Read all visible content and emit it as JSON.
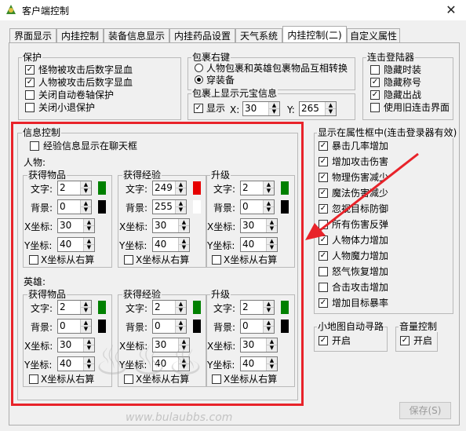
{
  "window": {
    "title": "客户端控制",
    "close": "✕"
  },
  "tabs": [
    "界面显示",
    "内挂控制",
    "装备信息显示",
    "内挂药品设置",
    "天气系统",
    "内挂控制(二)",
    "自定义属性"
  ],
  "protect": {
    "label": "保护",
    "items": [
      {
        "label": "怪物被攻击后数字显血",
        "checked": true
      },
      {
        "label": "人物被攻击后数字显血",
        "checked": true
      },
      {
        "label": "关闭自动卷轴保护",
        "checked": false
      },
      {
        "label": "关闭小退保护",
        "checked": false
      }
    ]
  },
  "bag": {
    "label": "包裹右键",
    "options": [
      "人物包裹和英雄包裹物品互相转换",
      "穿装备"
    ],
    "selected": 1
  },
  "ingot": {
    "label": "包裹上显示元宝信息",
    "show_label": "显示",
    "show_checked": true,
    "x_label": "X:",
    "x": "30",
    "y_label": "Y:",
    "y": "265"
  },
  "login": {
    "label": "连击登陆器",
    "items": [
      {
        "label": "隐藏时装",
        "checked": false
      },
      {
        "label": "隐藏称号",
        "checked": true
      },
      {
        "label": "隐藏出战",
        "checked": true
      },
      {
        "label": "使用旧连击界面",
        "checked": false
      }
    ]
  },
  "info": {
    "label": "信息控制",
    "exp_chat": {
      "label": "经验信息显示在聊天框",
      "checked": false
    },
    "person_label": "人物:",
    "hero_label": "英雄:",
    "text_label": "文字:",
    "bg_label": "背景:",
    "x_label": "X坐标:",
    "y_label": "Y坐标:",
    "right_label": "X坐标从右算",
    "person": [
      {
        "title": "获得物品",
        "text": "2",
        "bg": "0",
        "x": "30",
        "y": "40",
        "text_color": "#008000",
        "bg_color": "#000000"
      },
      {
        "title": "获得经验",
        "text": "249",
        "bg": "255",
        "x": "30",
        "y": "40",
        "text_color": "#e60000",
        "bg_color": "#ffffff"
      },
      {
        "title": "升级",
        "text": "2",
        "bg": "0",
        "x": "30",
        "y": "40",
        "text_color": "#008000",
        "bg_color": "#000000"
      }
    ],
    "hero": [
      {
        "title": "获得物品",
        "text": "2",
        "bg": "0",
        "x": "30",
        "y": "40",
        "text_color": "#008000",
        "bg_color": "#000000"
      },
      {
        "title": "获得经验",
        "text": "2",
        "bg": "0",
        "x": "30",
        "y": "40",
        "text_color": "#008000",
        "bg_color": "#000000"
      },
      {
        "title": "升级",
        "text": "2",
        "bg": "0",
        "x": "30",
        "y": "40",
        "text_color": "#008000",
        "bg_color": "#000000"
      }
    ]
  },
  "attr": {
    "label": "显示在属性框中(连击登录器有效)",
    "items": [
      {
        "label": "暴击几率增加",
        "checked": true
      },
      {
        "label": "增加攻击伤害",
        "checked": true
      },
      {
        "label": "物理伤害减少",
        "checked": true
      },
      {
        "label": "魔法伤害减少",
        "checked": true
      },
      {
        "label": "忽视目标防御",
        "checked": true
      },
      {
        "label": "所有伤害反弹",
        "checked": false
      },
      {
        "label": "人物体力增加",
        "checked": true
      },
      {
        "label": "人物魔力增加",
        "checked": true
      },
      {
        "label": "怒气恢复增加",
        "checked": false
      },
      {
        "label": "合击攻击增加",
        "checked": false
      },
      {
        "label": "增加目标暴率",
        "checked": true
      }
    ]
  },
  "minimap": {
    "label": "小地图自动寻路",
    "enable_label": "开启",
    "checked": true
  },
  "sound": {
    "label": "音量控制",
    "enable_label": "开启",
    "checked": true
  },
  "save_label": "保存(S)",
  "watermark": "www.bulaubbs.com",
  "colors": {
    "annotation_red": "#e8232a"
  }
}
